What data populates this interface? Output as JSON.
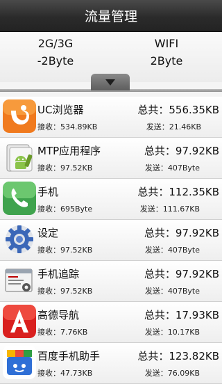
{
  "title": "流量管理",
  "summary": {
    "mobile_label": "2G/3G",
    "mobile_value": "-2Byte",
    "wifi_label": "WIFI",
    "wifi_value": "2Byte"
  },
  "apps": [
    {
      "name": "UC浏览器",
      "total": "总共：556.35KB",
      "recv": "接收：534.89KB",
      "sent": "发送：21.46KB",
      "icon": "uc-browser-icon"
    },
    {
      "name": "MTP应用程序",
      "total": "总共：97.92KB",
      "recv": "接收：97.52KB",
      "sent": "发送：407Byte",
      "icon": "android-app-icon"
    },
    {
      "name": "手机",
      "total": "总共：112.35KB",
      "recv": "接收：695Byte",
      "sent": "发送：111.67KB",
      "icon": "phone-icon"
    },
    {
      "name": "设定",
      "total": "总共：97.92KB",
      "recv": "接收：97.52KB",
      "sent": "发送：407Byte",
      "icon": "settings-icon"
    },
    {
      "name": "手机追踪",
      "total": "总共：97.92KB",
      "recv": "接收：97.52KB",
      "sent": "发送：407Byte",
      "icon": "phone-tracker-icon"
    },
    {
      "name": "高德导航",
      "total": "总共：17.93KB",
      "recv": "接收：7.76KB",
      "sent": "发送：10.17KB",
      "icon": "amap-navigation-icon"
    },
    {
      "name": "百度手机助手",
      "total": "总共：123.82KB",
      "recv": "接收：47.73KB",
      "sent": "发送：76.09KB",
      "icon": "baidu-assistant-icon"
    }
  ]
}
